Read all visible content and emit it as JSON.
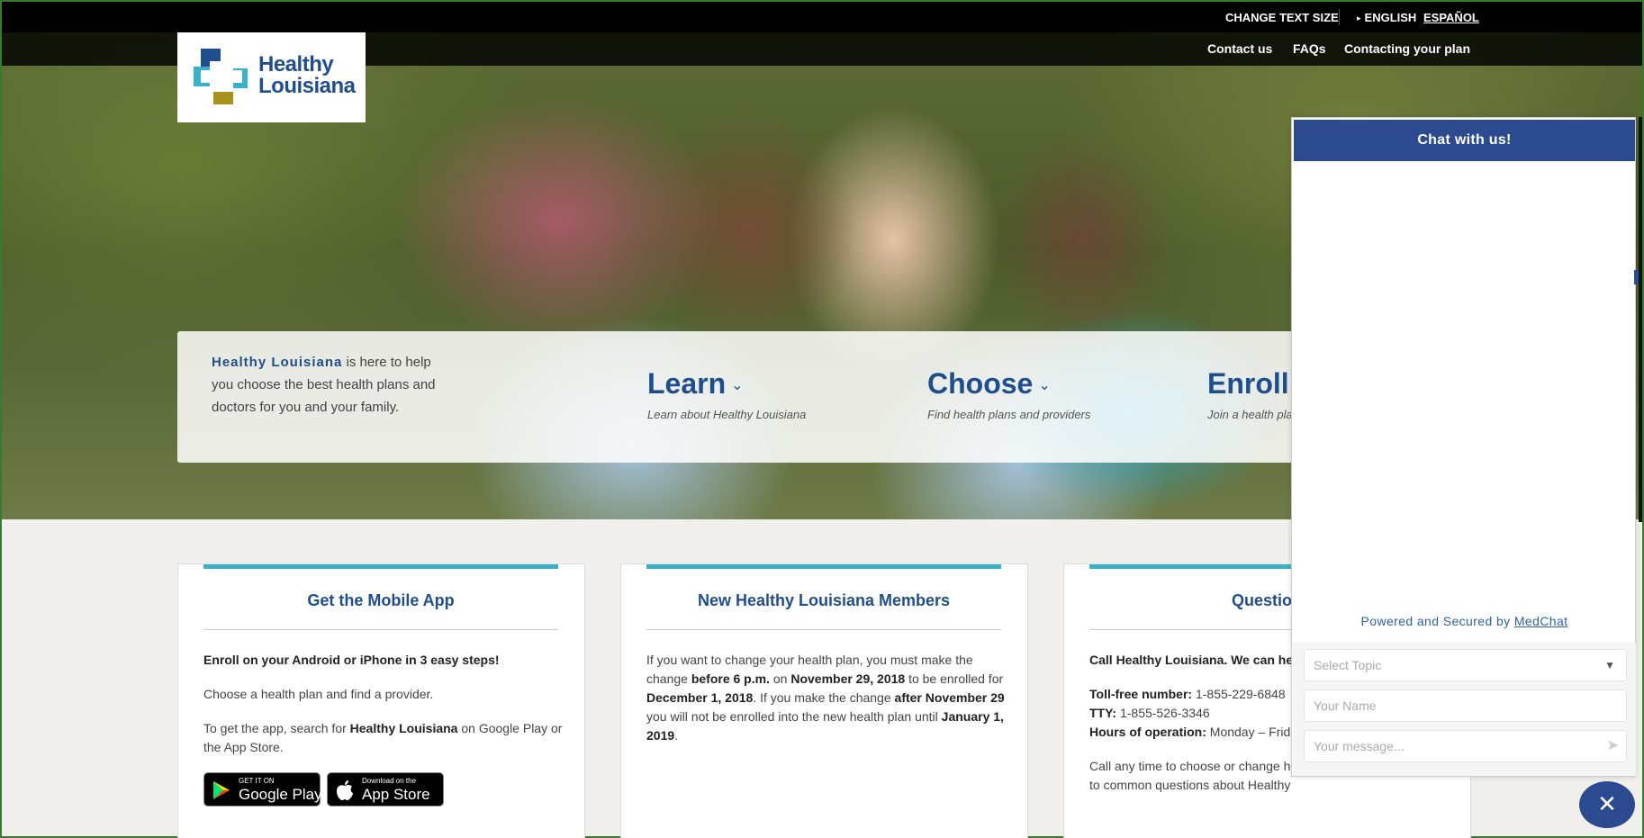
{
  "utility": {
    "change_text_size": "CHANGE TEXT SIZE",
    "english": "ENGLISH",
    "espanol": "ESPAÑOL"
  },
  "nav": {
    "contact_us": "Contact us",
    "faqs": "FAQs",
    "contacting_plan": "Contacting your plan"
  },
  "logo": {
    "line1": "Healthy",
    "line2": "Louisiana",
    "colors": {
      "blue": "#1f4e8c",
      "teal": "#39b1c9",
      "gold": "#a8921c"
    }
  },
  "hero": {
    "intro_brand": "Healthy Louisiana",
    "intro_rest": " is here to help you choose the best health plans and doctors for you and your family.",
    "ctas": [
      {
        "title": "Learn",
        "sub": "Learn about Healthy Louisiana",
        "icon": "chevron-down-icon"
      },
      {
        "title": "Choose",
        "sub": "Find health plans and providers",
        "icon": "chevron-down-icon"
      },
      {
        "title": "Enroll",
        "sub": "Join a health pla"
      }
    ]
  },
  "cards": {
    "app": {
      "title": "Get the Mobile App",
      "intro": "Enroll on your Android or iPhone in 3 easy steps!",
      "step": "Choose a health plan and find a provider.",
      "search_pre": "To get the app, search for ",
      "search_bold": "Healthy Louisiana",
      "search_post": " on Google Play or the App Store.",
      "google_small": "GET IT ON",
      "google_big": "Google Play",
      "apple_small": "Download on the",
      "apple_big": "App Store"
    },
    "members": {
      "title": "New Healthy Louisiana Members",
      "t1": "If you want to change your health plan, you must make the change ",
      "b1": "before 6 p.m.",
      "t2": " on ",
      "b2": "November 29, 2018",
      "t3": " to be enrolled for ",
      "b3": "December 1, 2018",
      "t4": ". If you make the change ",
      "b4": "after November 29",
      "t5": " you will not be enrolled into the new health plan until ",
      "b5": "January 1, 2019",
      "t6": "."
    },
    "questions": {
      "title": "Question",
      "call": "Call Healthy Louisiana.  We can he",
      "tollfree_label": "Toll-free number:",
      "tollfree": " 1-855-229-6848",
      "tty_label": "TTY:",
      "tty": " 1-855-526-3346",
      "hours_label": "Hours of operation:",
      "hours": " Monday – Frid",
      "anytime1": "Call any time to choose or change he",
      "anytime2": "to common questions about Healthy"
    }
  },
  "chat": {
    "header": "Chat with us!",
    "powered": "Powered and Secured by ",
    "powered_link": "MedChat",
    "topic_placeholder": "Select Topic",
    "name_placeholder": "Your Name",
    "message_placeholder": "Your message...",
    "close": "✕"
  }
}
